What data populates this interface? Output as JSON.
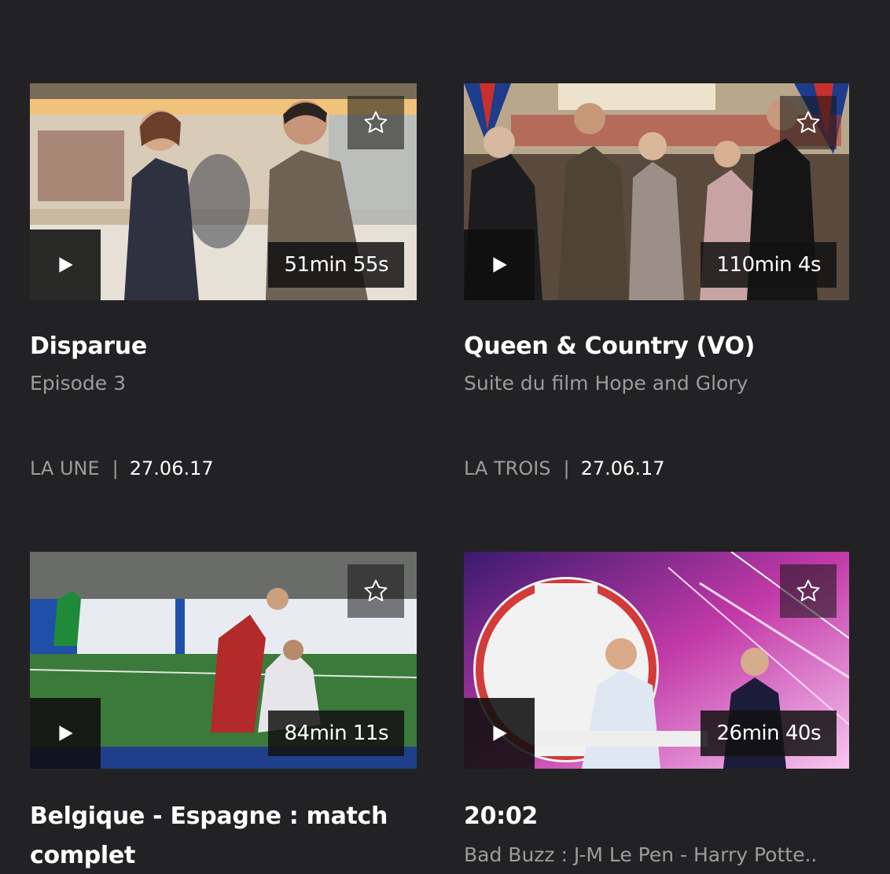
{
  "colors": {
    "background": "#222224",
    "title": "#ffffff",
    "muted": "#9c9c9c",
    "overlay": "#121212"
  },
  "icons": {
    "play": "play-icon",
    "favorite": "star-outline-icon"
  },
  "cards": [
    {
      "duration": "51min 55s",
      "title": "Disparue",
      "subtitle": "Episode 3",
      "channel": "LA UNE",
      "separator": "|",
      "date": "27.06.17"
    },
    {
      "duration": "110min 4s",
      "title": "Queen & Country (VO)",
      "subtitle": "Suite du film Hope and Glory",
      "channel": "LA TROIS",
      "separator": "|",
      "date": "27.06.17"
    },
    {
      "duration": "84min 11s",
      "title": "Belgique - Espagne : match complet",
      "subtitle": "",
      "channel": "",
      "separator": "",
      "date": ""
    },
    {
      "duration": "26min 40s",
      "title": "20:02",
      "subtitle": "Bad Buzz : J-M Le Pen - Harry Potte..",
      "channel": "",
      "separator": "",
      "date": ""
    }
  ]
}
